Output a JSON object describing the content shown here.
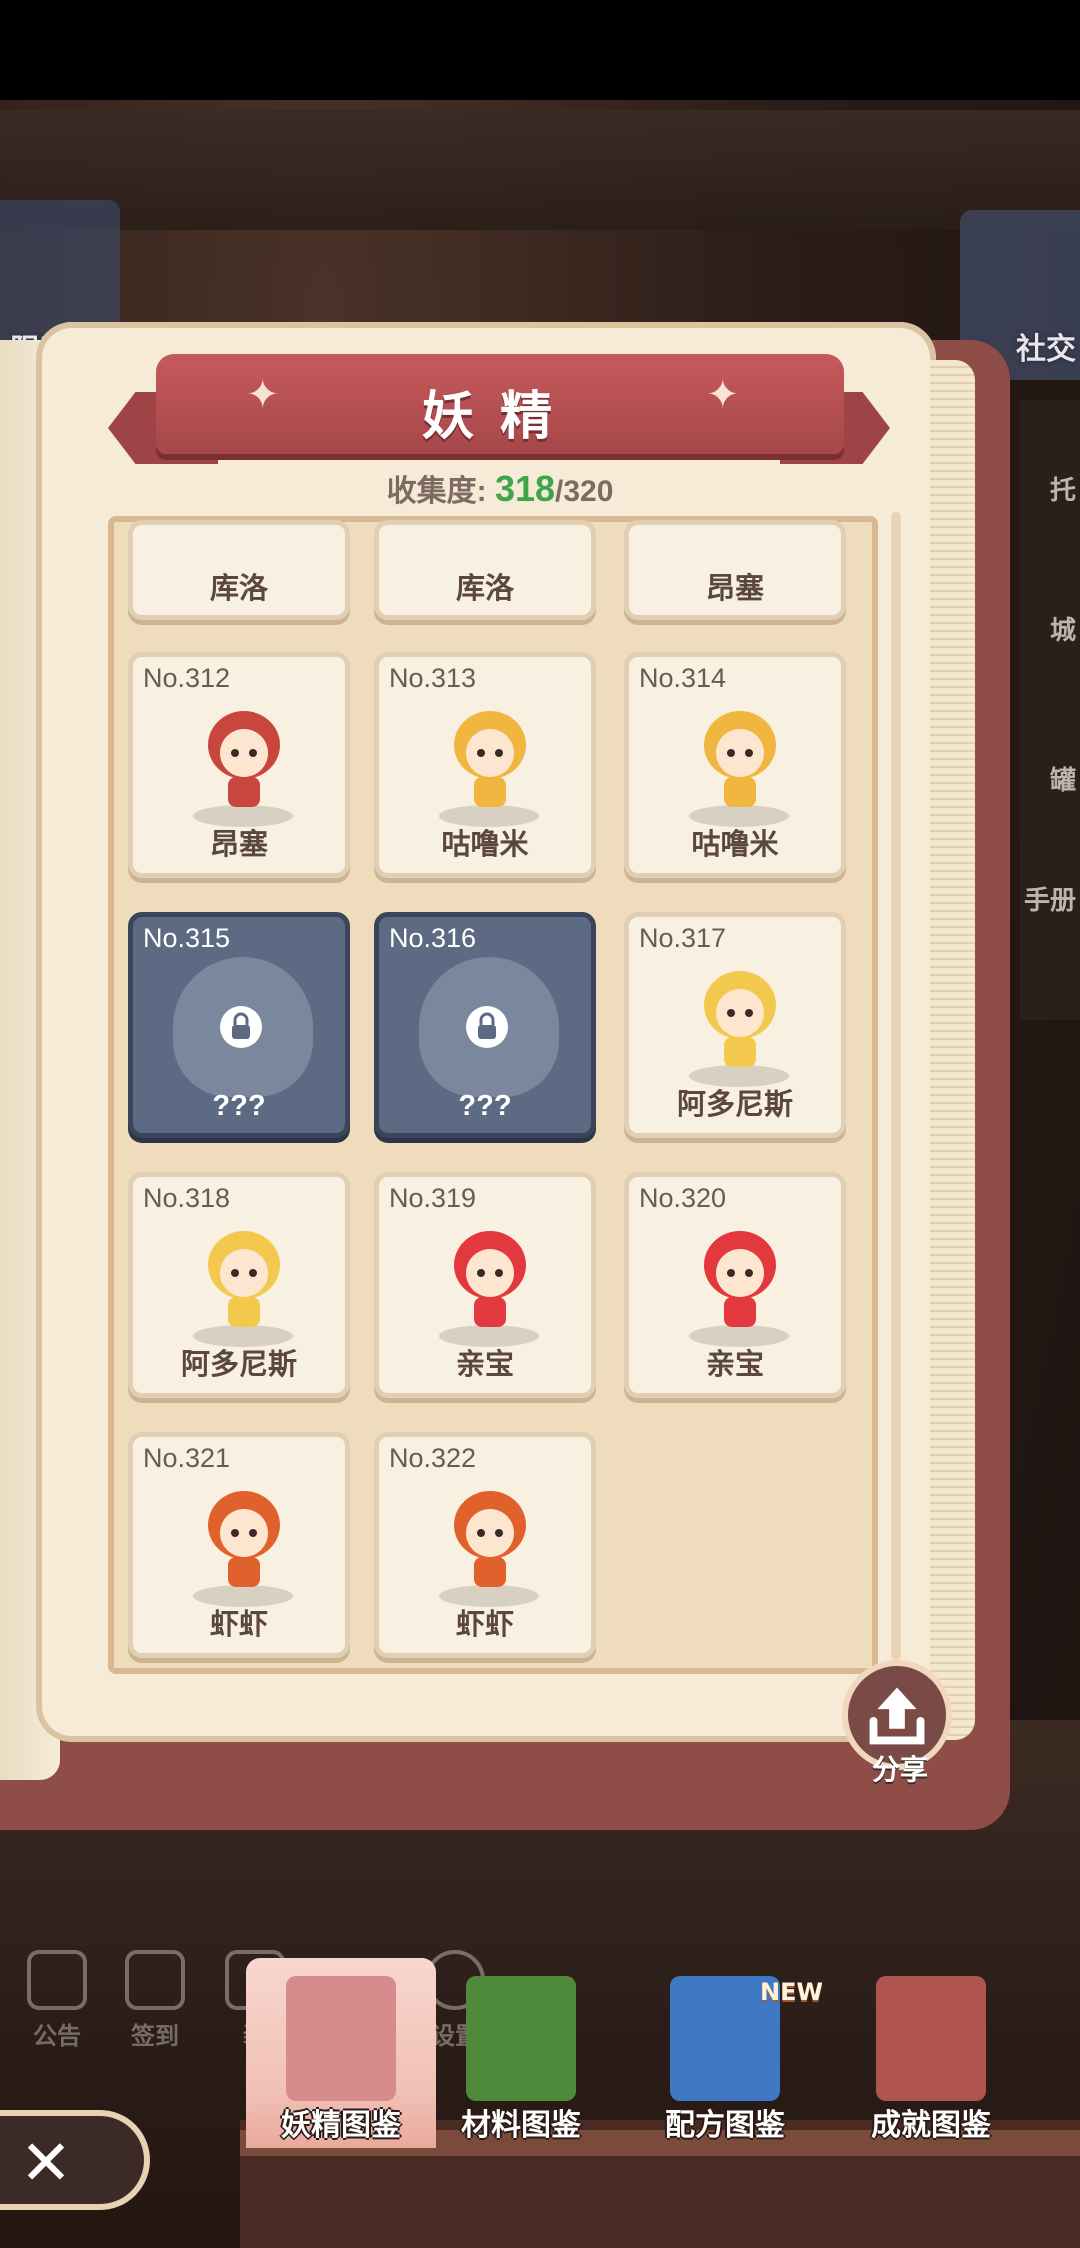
{
  "window": {
    "title": "妖精"
  },
  "collection": {
    "label": "收集度:",
    "current": "318",
    "total": "/320"
  },
  "left_tab_label": "限时活",
  "right_tab_label": "社交",
  "right_strip": [
    "托",
    "城",
    "罐",
    "手册"
  ],
  "top_row": [
    {
      "name": "库洛"
    },
    {
      "name": "库洛"
    },
    {
      "name": "昂塞"
    }
  ],
  "cards": [
    {
      "no": "No.312",
      "name": "昂塞",
      "locked": false,
      "color": "#c9463f"
    },
    {
      "no": "No.313",
      "name": "咕噜米",
      "locked": false,
      "color": "#f1b640"
    },
    {
      "no": "No.314",
      "name": "咕噜米",
      "locked": false,
      "color": "#f1b640"
    },
    {
      "no": "No.315",
      "name": "???",
      "locked": true
    },
    {
      "no": "No.316",
      "name": "???",
      "locked": true
    },
    {
      "no": "No.317",
      "name": "阿多尼斯",
      "locked": false,
      "color": "#f3c94d"
    },
    {
      "no": "No.318",
      "name": "阿多尼斯",
      "locked": false,
      "color": "#f3c94d"
    },
    {
      "no": "No.319",
      "name": "亲宝",
      "locked": false,
      "color": "#e2383e"
    },
    {
      "no": "No.320",
      "name": "亲宝",
      "locked": false,
      "color": "#e2383e"
    },
    {
      "no": "No.321",
      "name": "虾虾",
      "locked": false,
      "color": "#e0612c"
    },
    {
      "no": "No.322",
      "name": "虾虾",
      "locked": false,
      "color": "#e0612c"
    }
  ],
  "share": {
    "label": "分享"
  },
  "faded_menu": [
    "公告",
    "签到",
    "装",
    "",
    "设置"
  ],
  "tabs": [
    {
      "label": "妖精图鉴",
      "active": true,
      "icon": "fairy-book-icon",
      "color": "#d88b8d"
    },
    {
      "label": "材料图鉴",
      "active": false,
      "icon": "material-book-icon",
      "color": "#4f8a3b"
    },
    {
      "label": "配方图鉴",
      "active": false,
      "icon": "recipe-book-icon",
      "color": "#3f78c4"
    },
    {
      "label": "成就图鉴",
      "active": false,
      "icon": "achievement-book-icon",
      "color": "#b0554d"
    }
  ],
  "new_badge": "NEW",
  "close": {
    "icon": "close-icon"
  }
}
